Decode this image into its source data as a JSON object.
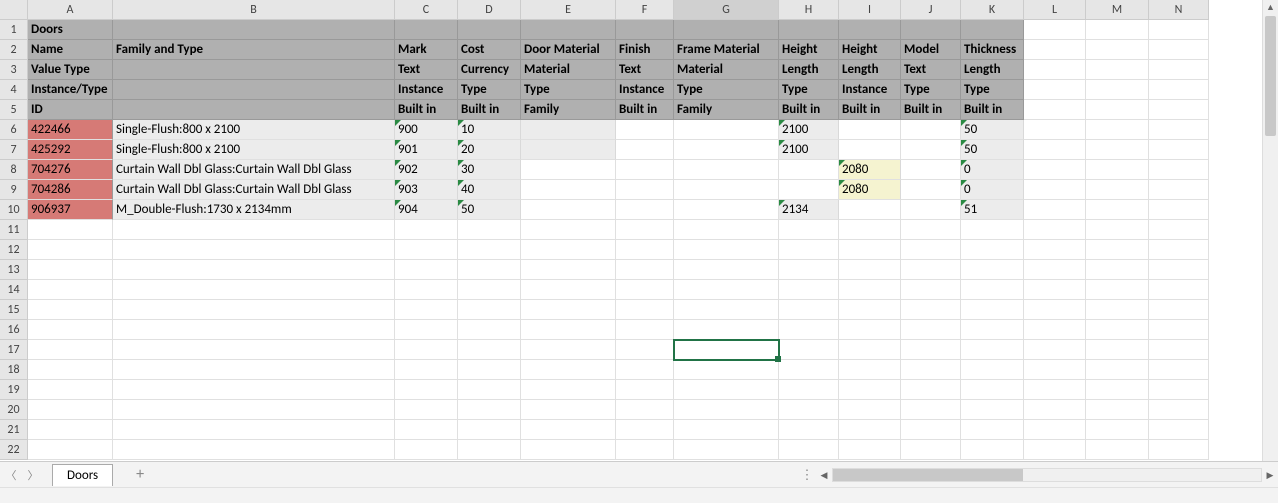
{
  "columns": [
    "A",
    "B",
    "C",
    "D",
    "E",
    "F",
    "G",
    "H",
    "I",
    "J",
    "K",
    "L",
    "M",
    "N"
  ],
  "activeCol": "G",
  "rowCount": 22,
  "selectedCell": {
    "row": 17,
    "col": "G"
  },
  "sheetTab": "Doors",
  "header": {
    "r1": {
      "A": "Doors"
    },
    "r2": {
      "A": "Name",
      "B": "Family and Type",
      "C": "Mark",
      "D": "Cost",
      "E": "Door Material",
      "F": "Finish",
      "G": "Frame Material",
      "H": "Height",
      "I": "Height",
      "J": "Model",
      "K": "Thickness"
    },
    "r3": {
      "A": "Value Type",
      "C": "Text",
      "D": "Currency",
      "E": "Material",
      "F": "Text",
      "G": "Material",
      "H": "Length",
      "I": "Length",
      "J": "Text",
      "K": "Length"
    },
    "r4": {
      "A": "Instance/Type",
      "C": "Instance",
      "D": "Type",
      "E": "Type",
      "F": "Instance",
      "G": "Type",
      "H": "Type",
      "I": "Instance",
      "J": "Type",
      "K": "Type"
    },
    "r5": {
      "A": "ID",
      "C": "Built in",
      "D": "Built in",
      "E": "Family",
      "F": "Built in",
      "G": "Family",
      "H": "Built in",
      "I": "Built in",
      "J": "Built in",
      "K": "Built in"
    }
  },
  "dataRows": [
    {
      "A": "422466",
      "B": "Single-Flush:800 x 2100",
      "C": "900",
      "D": "10",
      "H": "2100",
      "K": "50"
    },
    {
      "A": "425292",
      "B": "Single-Flush:800 x 2100",
      "C": "901",
      "D": "20",
      "H": "2100",
      "K": "50"
    },
    {
      "A": "704276",
      "B": "Curtain Wall Dbl Glass:Curtain Wall Dbl Glass",
      "C": "902",
      "D": "30",
      "I": "2080",
      "K": "0"
    },
    {
      "A": "704286",
      "B": "Curtain Wall Dbl Glass:Curtain Wall Dbl Glass",
      "C": "903",
      "D": "40",
      "I": "2080",
      "K": "0"
    },
    {
      "A": "906937",
      "B": "M_Double-Flush:1730 x 2134mm",
      "C": "904",
      "D": "50",
      "H": "2134",
      "K": "51"
    }
  ]
}
